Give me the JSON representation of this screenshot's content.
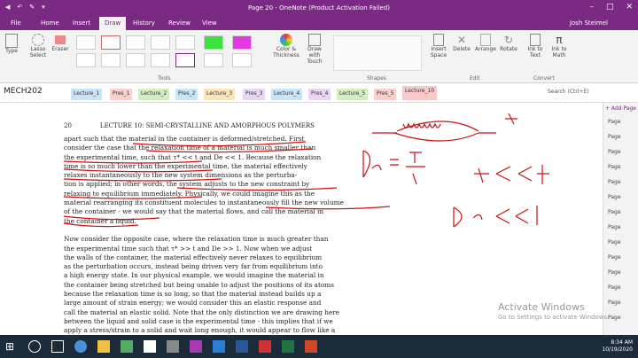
{
  "window": {
    "title": "Page 20 - OneNote (Product Activation Failed)",
    "user": "Josh Steimel"
  },
  "tabs": [
    "File",
    "Home",
    "Insert",
    "Draw",
    "History",
    "Review",
    "View"
  ],
  "ribbon": {
    "type": "Type",
    "lasso": "Lasso Select",
    "eraser": "Eraser",
    "color_thickness": "Color & Thickness",
    "draw_touch": "Draw with Touch",
    "tools_group": "Tools",
    "insert_space": "Insert Space",
    "delete": "Delete",
    "arrange": "Arrange",
    "rotate": "Rotate",
    "ink_text": "Ink to Text",
    "ink_math": "Ink to Math",
    "shapes_group": "Shapes",
    "edit_group": "Edit",
    "convert_group": "Convert"
  },
  "notebook": {
    "name": "MECH202",
    "sections": [
      "Lecture_1",
      "Pres_1",
      "Lecture_2",
      "Pres_2",
      "Lecture_3",
      "Pres_3",
      "Lecture_4",
      "Pres_4",
      "Lecture_5",
      "Pres_5",
      "Lecture_10"
    ],
    "search_placeholder": "Search (Ctrl+E)"
  },
  "pdf": {
    "page_num": "20",
    "header": "LECTURE 10: SEMI-CRYSTALLINE AND AMORPHOUS POLYMERS",
    "lines": [
      "apart such that the material in the container is deformed/stretched. First",
      "consider the case that the relaxation time of a material is much smaller than",
      "the experimental time, such that τ* << t and De << 1. Because the relaxation",
      "time is so much lower than the experimental time, the material effectively",
      "relaxes instantaneously to the new system dimensions as the perturba-",
      "tion is applied; in other words, the system adjusts to the new constraint by",
      "relaxing to equilibrium immediately. Physically, we could imagine this as the",
      "material rearranging its constituent molecules to instantaneously fill the new volume",
      "of the container - we would say that the material flows, and call the material in",
      "the container a liquid.",
      "",
      "Now consider the opposite case, where the relaxation time is much greater than",
      "the experimental time such that τ* >> t and De >> 1. Now when we adjust",
      "the walls of the container, the material effectively never relaxes to equilibrium",
      "as the perturbation occurs, instead being driven very far from equilibrium into",
      "a high energy state. In our physical example, we would imagine the material in",
      "the container being stretched but being unable to adjust the positions of its atoms",
      "because the relaxation time is so long, so that the material instead builds up a",
      "large amount of strain energy; we would consider this an elastic response and",
      "call the material an elastic solid. Note that the only distinction we are drawing here",
      "between the liquid and solid case is the experimental time - this implies that if we",
      "apply a stress/strain to a solid and wait long enough, it would appear to flow like a"
    ]
  },
  "page_panel": {
    "add": "+ Add Page",
    "items": [
      "Page",
      "Page",
      "Page",
      "Page",
      "Page",
      "Page",
      "Page",
      "Page",
      "Page",
      "Page",
      "Page",
      "Page",
      "Page",
      "Page"
    ]
  },
  "watermark": {
    "title": "Activate Windows",
    "sub": "Go to Settings to activate Windows."
  },
  "tray": {
    "time": "8:34 AM",
    "date": "10/19/2020"
  },
  "colors": {
    "accent": "#7b2a84",
    "ink": "#cc1111"
  }
}
